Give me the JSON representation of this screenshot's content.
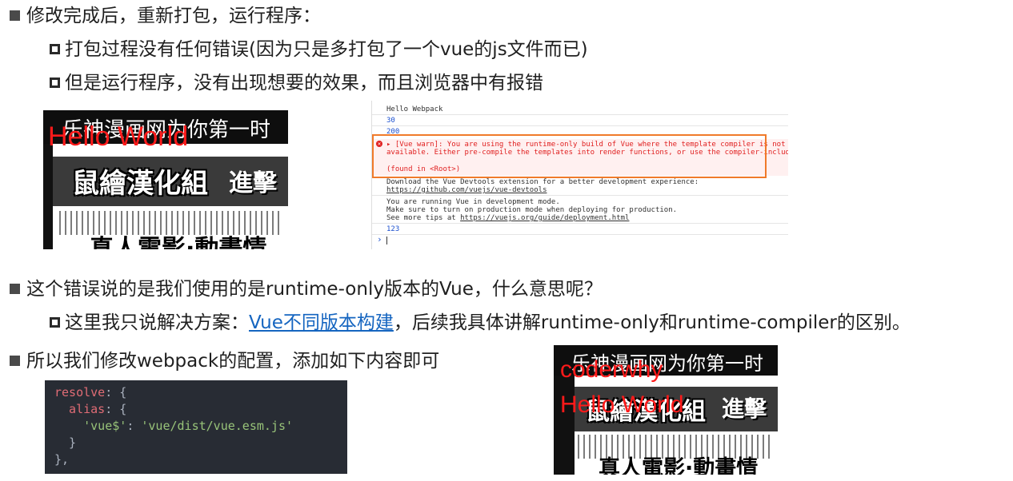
{
  "bullets": {
    "b1": "修改完成后，重新打包，运行程序：",
    "b1_sub1": "打包过程没有任何错误(因为只是多打包了一个vue的js文件而已)",
    "b1_sub2": "但是运行程序，没有出现想要的效果，而且浏览器中有报错",
    "b2": "这个错误说的是我们使用的是runtime-only版本的Vue，什么意思呢？",
    "b2_sub_prefix": "这里我只说解决方案：",
    "b2_sub_link": "Vue不同版本构建",
    "b2_sub_suffix": "，后续我具体讲解runtime-only和runtime-compiler的区别。",
    "b3": "所以我们修改webpack的配置，添加如下内容即可"
  },
  "manga1": {
    "top_text": "乐神漫画网为你第一时",
    "overlay": "Hello World",
    "mid_text": "鼠繪漢化組",
    "mid_tag": "進擊",
    "bottom_text": "真人電影·動畫情"
  },
  "manga2": {
    "top_text": "乐神漫画网为你第一时",
    "overlay1": "coderwhy",
    "overlay2": "Hello World",
    "mid_text": "鼠繪漢化組",
    "mid_tag": "進擊",
    "bottom_text": "真人電影·動畫情"
  },
  "console": {
    "line1": "Hello Webpack",
    "line2": "30",
    "line3": "200",
    "err1": "▸ [Vue warn]: You are using the runtime-only build of Vue where the template compiler is not",
    "err2": "available. Either pre-compile the templates into render functions, or use the compiler-included build.",
    "err3": "(found in <Root>)",
    "dev1": "Download the Vue Devtools extension for a better development experience:",
    "dev2": "https://github.com/vuejs/vue-devtools",
    "info1": "You are running Vue in development mode.",
    "info2": "Make sure to turn on production mode when deploying for production.",
    "info3_prefix": "See more tips at ",
    "info3_link": "https://vuejs.org/guide/deployment.html",
    "line4": "123",
    "prompt": "›"
  },
  "code": {
    "l1_key": "resolve",
    "l1_rest": ": {",
    "l2_key": "  alias",
    "l2_rest": ": {",
    "l3_pre": "    ",
    "l3_key": "'vue$'",
    "l3_mid": ": ",
    "l3_val": "'vue/dist/vue.esm.js'",
    "l4": "  }",
    "l5": "},"
  },
  "colors": {
    "error_red": "#e02020",
    "highlight_orange": "#f07a2a",
    "link_blue": "#1565c0",
    "code_bg": "#282c34"
  }
}
